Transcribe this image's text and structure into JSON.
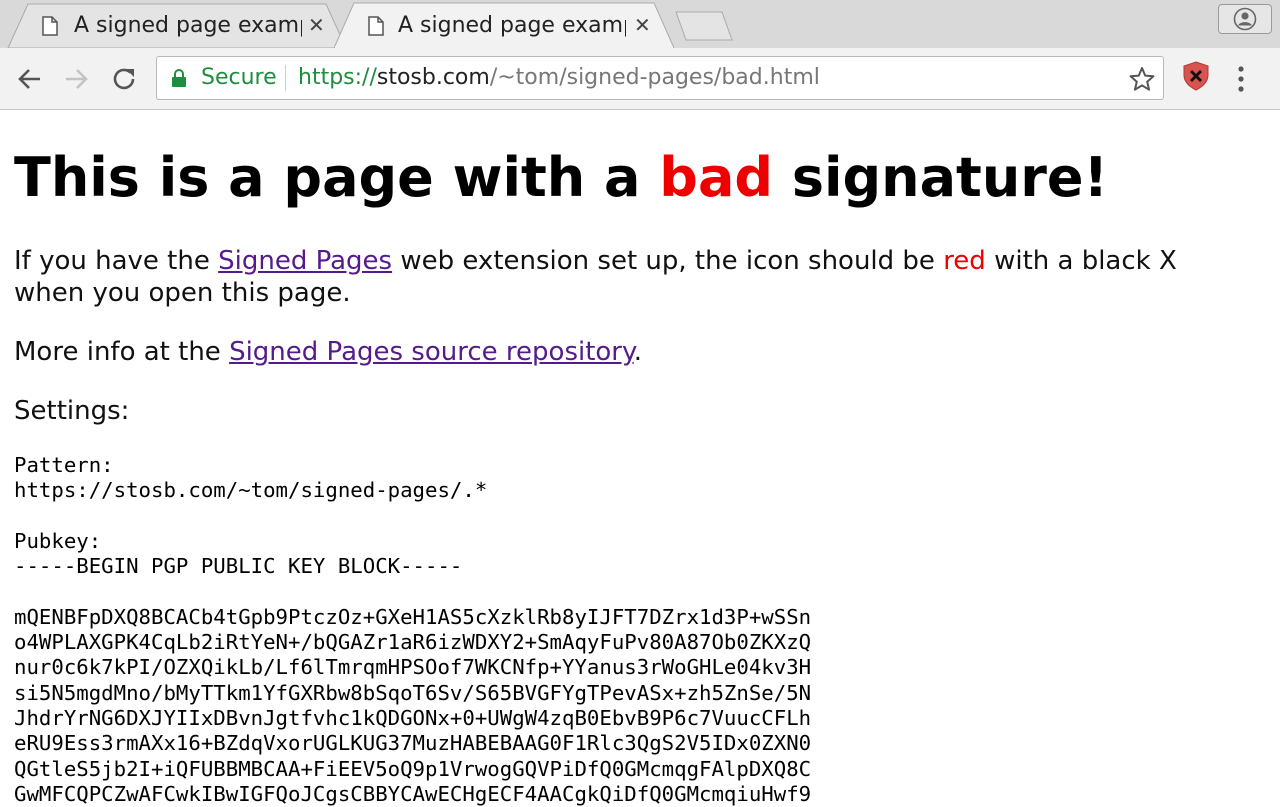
{
  "tabs": [
    {
      "title": "A signed page example",
      "active": false
    },
    {
      "title": "A signed page example",
      "active": true
    }
  ],
  "toolbar": {
    "secure_label": "Secure",
    "url_scheme": "https://",
    "url_host": "stosb.com",
    "url_path": "/~tom/signed-pages/bad.html"
  },
  "page": {
    "heading_pre": "This is a page with a ",
    "heading_bad": "bad",
    "heading_post": " signature!",
    "p1_pre": "If you have the ",
    "p1_link": "Signed Pages",
    "p1_mid": " web extension set up, the icon should be ",
    "p1_red": "red",
    "p1_post": " with a black X",
    "p1_line2": "when you open this page.",
    "p2_pre": "More info at the ",
    "p2_link": "Signed Pages source repository",
    "p2_post": ".",
    "settings_label": "Settings:",
    "pattern_label": "Pattern:",
    "pattern_value": "https://stosb.com/~tom/signed-pages/.*",
    "pubkey_label": "Pubkey:",
    "pubkey_header": "-----BEGIN PGP PUBLIC KEY BLOCK-----",
    "key_lines": [
      "mQENBFpDXQ8BCACb4tGpb9PtczOz+GXeH1AS5cXzklRb8yIJFT7DZrx1d3P+wSSn",
      "o4WPLAXGPK4CqLb2iRtYeN+/bQGAZr1aR6izWDXY2+SmAqyFuPv80A87Ob0ZKXzQ",
      "nur0c6k7kPI/OZXQikLb/Lf6lTmrqmHPSOof7WKCNfp+YYanus3rWoGHLe04kv3H",
      "si5N5mgdMno/bMyTTkm1YfGXRbw8bSqoT6Sv/S65BVGFYgTPevASx+zh5ZnSe/5N",
      "JhdrYrNG6DXJYIIxDBvnJgtfvhc1kQDGONx+0+UWgW4zqB0EbvB9P6c7VuucCFLh",
      "eRU9Ess3rmAXx16+BZdqVxorUGLKUG37MuzHABEBAAG0F1Rlc3QgS2V5IDx0ZXN0",
      "QGtleS5jb2I+iQFUBBMBCAA+FiEEV5oQ9p1VrwogGQVPiDfQ0GMcmqgFAlpDXQ8C",
      "GwMFCQPCZwAFCwkIBwIGFQoJCgsCBBYCAwECHgECF4AACgkQiDfQ0GMcmqiuHwf9"
    ]
  },
  "colors": {
    "secure_green": "#1e8e3e",
    "bad_red": "#e00000",
    "link_purple": "#551a8b",
    "ext_icon_red": "#d9534f"
  }
}
